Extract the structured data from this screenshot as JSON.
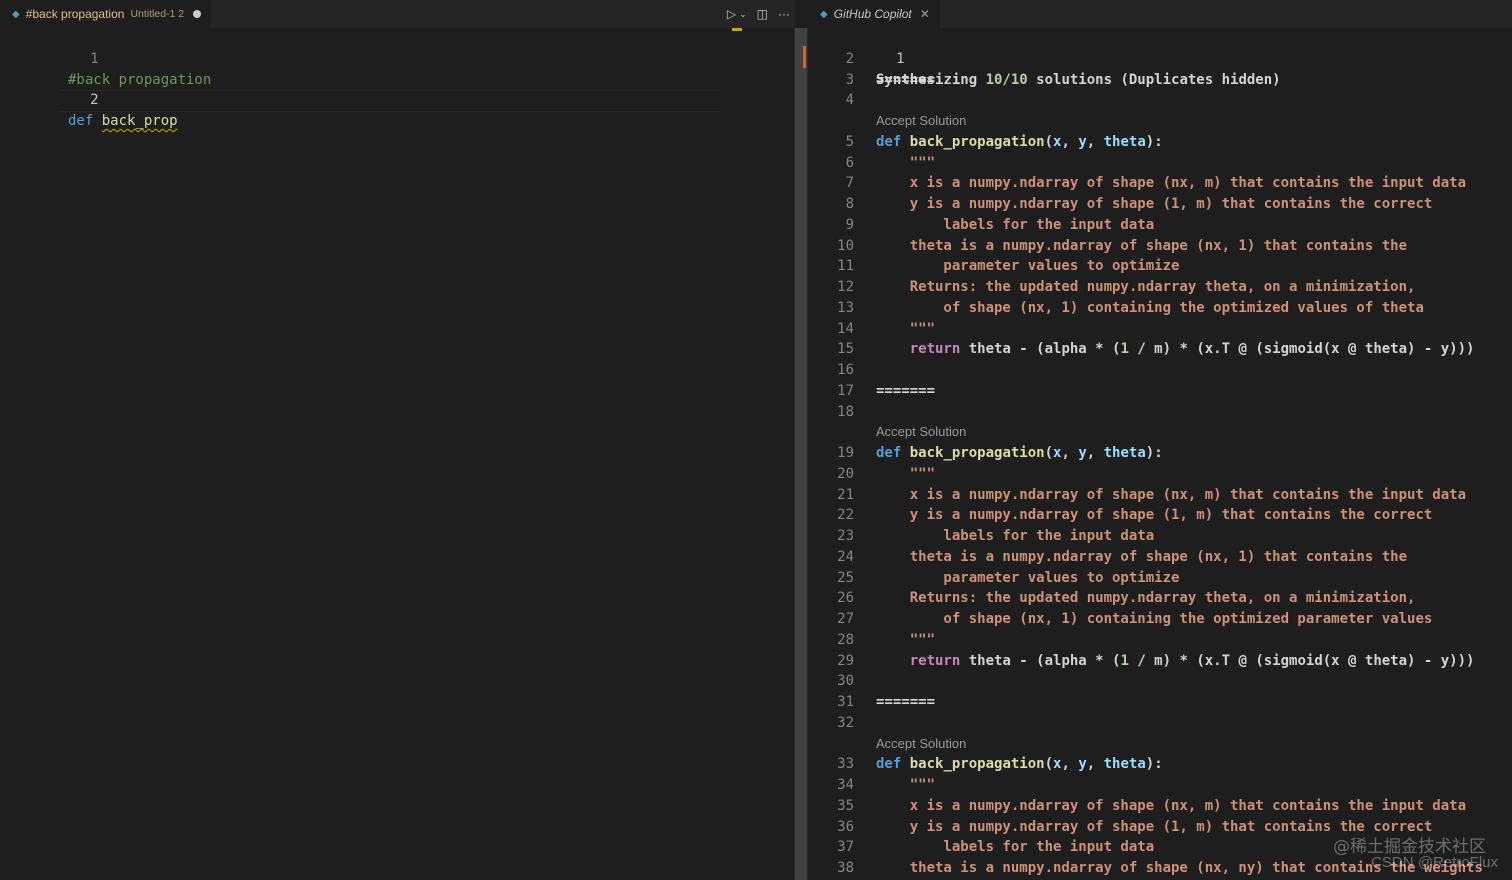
{
  "left_editor": {
    "tab": {
      "name": "#back propagation",
      "description": "Untitled-1 2"
    },
    "lines": [
      {
        "num": "1",
        "text": "#back propagation"
      },
      {
        "num": "2",
        "kw": "def",
        "fn": "back_prop"
      }
    ]
  },
  "right_panel": {
    "tab": {
      "name": "GitHub Copilot"
    },
    "header": {
      "num": "1",
      "pre": "Synthesizing ",
      "count": "10/10",
      "post": " solutions (Duplicates hidden)"
    },
    "codelens_label": "Accept Solution",
    "separator": "=======",
    "blocks": [
      {
        "pre_lines": [
          "2",
          "3",
          "4"
        ],
        "def_num": "5",
        "doc": [
          {
            "num": "6",
            "text": "    \"\"\""
          },
          {
            "num": "7",
            "text": "    x is a numpy.ndarray of shape (nx, m) that contains the input data"
          },
          {
            "num": "8",
            "text": "    y is a numpy.ndarray of shape (1, m) that contains the correct"
          },
          {
            "num": "9",
            "text": "        labels for the input data"
          },
          {
            "num": "10",
            "text": "    theta is a numpy.ndarray of shape (nx, 1) that contains the"
          },
          {
            "num": "11",
            "text": "        parameter values to optimize"
          },
          {
            "num": "12",
            "text": "    Returns: the updated numpy.ndarray theta, on a minimization,"
          },
          {
            "num": "13",
            "text": "        of shape (nx, 1) containing the optimized values of theta"
          },
          {
            "num": "14",
            "text": "    \"\"\""
          }
        ],
        "ret_num": "15",
        "post_lines": [
          "16",
          "17",
          "18"
        ]
      },
      {
        "def_num": "19",
        "doc": [
          {
            "num": "20",
            "text": "    \"\"\""
          },
          {
            "num": "21",
            "text": "    x is a numpy.ndarray of shape (nx, m) that contains the input data"
          },
          {
            "num": "22",
            "text": "    y is a numpy.ndarray of shape (1, m) that contains the correct"
          },
          {
            "num": "23",
            "text": "        labels for the input data"
          },
          {
            "num": "24",
            "text": "    theta is a numpy.ndarray of shape (nx, 1) that contains the"
          },
          {
            "num": "25",
            "text": "        parameter values to optimize"
          },
          {
            "num": "26",
            "text": "    Returns: the updated numpy.ndarray theta, on a minimization,"
          },
          {
            "num": "27",
            "text": "        of shape (nx, 1) containing the optimized parameter values"
          },
          {
            "num": "28",
            "text": "    \"\"\""
          }
        ],
        "ret_num": "29",
        "post_lines": [
          "30",
          "31",
          "32"
        ]
      },
      {
        "def_num": "33",
        "doc": [
          {
            "num": "34",
            "text": "    \"\"\""
          },
          {
            "num": "35",
            "text": "    x is a numpy.ndarray of shape (nx, m) that contains the input data"
          },
          {
            "num": "36",
            "text": "    y is a numpy.ndarray of shape (1, m) that contains the correct"
          },
          {
            "num": "37",
            "text": "        labels for the input data"
          },
          {
            "num": "38",
            "text": "    theta is a numpy.ndarray of shape (nx, ny) that contains the weights"
          }
        ]
      }
    ],
    "def_line": {
      "kw": "def",
      "fn": "back_propagation",
      "p1": "x",
      "p2": "y",
      "p3": "theta",
      "open": "(",
      "comma": ", ",
      "close": "):"
    },
    "return_line": {
      "indent": "    ",
      "kw": "return",
      "expr": " theta - (alpha * (",
      "one": "1",
      "rest": " / m) * (x.T @ (sigmoid(x @ theta) - y)))"
    }
  },
  "watermark": {
    "line1": "@稀土掘金技术社区",
    "line2": "CSDN @RetroFlux"
  },
  "colors": {
    "editor_bg": "#1e1e1e",
    "comment": "#6a9955",
    "keyword": "#569cd6",
    "function": "#dcdcaa",
    "docstring": "#ce9178",
    "control": "#c586c0",
    "param": "#9cdcfe",
    "modified_tab": "#e2c08d"
  },
  "icons": [
    "run-icon",
    "chevron-down-icon",
    "split-editor-icon",
    "more-actions-icon",
    "python-file-icon",
    "close-icon"
  ]
}
